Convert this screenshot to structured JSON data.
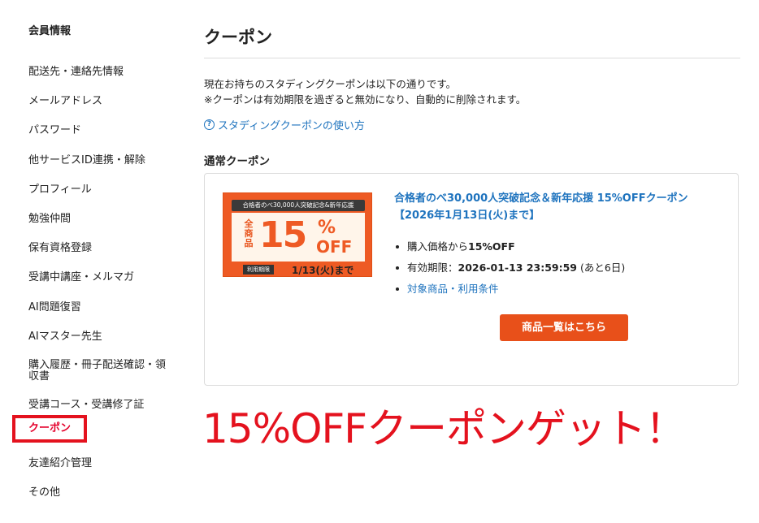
{
  "sidebar": {
    "title": "会員情報",
    "items": [
      {
        "label": "配送先・連絡先情報"
      },
      {
        "label": "メールアドレス"
      },
      {
        "label": "パスワード"
      },
      {
        "label": "他サービスID連携・解除"
      },
      {
        "label": "プロフィール"
      },
      {
        "label": "勉強仲間"
      },
      {
        "label": "保有資格登録"
      },
      {
        "label": "受講中講座・メルマガ"
      },
      {
        "label": "AI問題復習"
      },
      {
        "label": "AIマスター先生"
      },
      {
        "label": "購入履歴・冊子配送確認・領収書"
      },
      {
        "label": "受講コース・受講修了証"
      },
      {
        "label": "クーポン"
      },
      {
        "label": "友達紹介管理"
      },
      {
        "label": "その他"
      }
    ]
  },
  "main": {
    "title": "クーポン",
    "intro_line1": "現在お持ちのスタディングクーポンは以下の通りです。",
    "intro_line2": "※クーポンは有効期限を過ぎると無効になり、自動的に削除されます。",
    "help_link": "スタディングクーポンの使い方",
    "section_title": "通常クーポン"
  },
  "coupon": {
    "banner": {
      "top_text": "合格者のべ30,000人突破記念&新年応援",
      "label_vertical": "全商品",
      "big_number": "15",
      "percent": "%",
      "off": "OFF",
      "period_tag": "利用期限",
      "period_date": "1/13(火)まで"
    },
    "title": "合格者のべ30,000人突破記念＆新年応援 15%OFFクーポン【2026年1月13日(火)まで】",
    "detail_price_prefix": "購入価格から",
    "detail_price_value": "15%OFF",
    "detail_expiry_prefix": "有効期限：",
    "detail_expiry_value": "2026-01-13 23:59:59",
    "detail_expiry_suffix": " (あと6日)",
    "detail_terms_link": "対象商品・利用条件",
    "cta_label": "商品一覧はこちら"
  },
  "overlay": {
    "text": "15%OFFクーポンゲット！",
    "color": "#e4121e"
  },
  "colors": {
    "accent": "#e8501a",
    "link": "#1e73be",
    "highlight_border": "#e4121e"
  }
}
